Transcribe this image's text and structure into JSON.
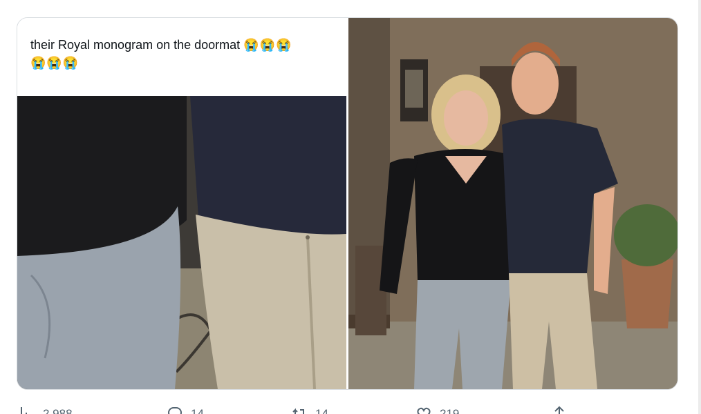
{
  "tweet": {
    "caption": "their Royal monogram on the doormat",
    "caption_emoji_line1": "😭😭😭",
    "caption_emoji_line2": "😭😭😭"
  },
  "media": {
    "left_panel": "cropped close-up photo",
    "right_panel": "full photo"
  },
  "actions": {
    "views_count": "2,988",
    "replies_count": "14",
    "reposts_count": "14",
    "likes_count": "219"
  },
  "colors": {
    "text_primary": "#0f1419",
    "text_secondary": "#536471",
    "border": "#d9dde1"
  },
  "icons": [
    "views-icon",
    "reply-icon",
    "repost-icon",
    "like-icon",
    "share-icon"
  ]
}
